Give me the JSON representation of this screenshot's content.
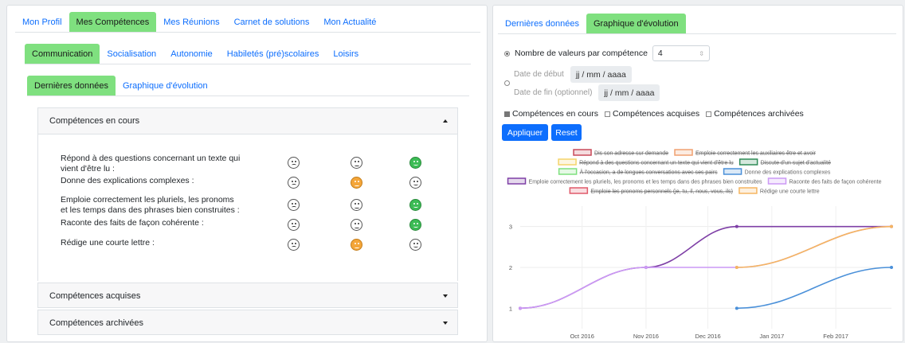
{
  "left": {
    "main_tabs": [
      "Mon Profil",
      "Mes Compétences",
      "Mes Réunions",
      "Carnet de solutions",
      "Mon Actualité"
    ],
    "main_active": 1,
    "sub_tabs": [
      "Communication",
      "Socialisation",
      "Autonomie",
      "Habiletés (pré)scolaires",
      "Loisirs"
    ],
    "sub_active": 0,
    "view_tabs": [
      "Dernières données",
      "Graphique d'évolution"
    ],
    "view_active": 0,
    "accordion": {
      "en_cours": "Compétences en cours",
      "acquises": "Compétences acquises",
      "archivees": "Compétences archivées"
    },
    "competences": [
      {
        "line1": "Répond à des questions concernant un texte qui",
        "line2": "vient d'être lu :",
        "level": "green"
      },
      {
        "line1": "Donne des explications complexes :",
        "line2": "",
        "level": "orange"
      },
      {
        "line1": "Emploie correctement les pluriels, les pronoms",
        "line2": "et les temps dans des phrases bien construites :",
        "level": "green"
      },
      {
        "line1": "Raconte des faits de façon cohérente :",
        "line2": "",
        "level": "green"
      },
      {
        "line1": "Rédige une courte lettre :",
        "line2": "",
        "level": "orange"
      }
    ]
  },
  "right": {
    "tabs": [
      "Dernières données",
      "Graphique d'évolution"
    ],
    "active": 1,
    "nb_label": "Nombre de valeurs par compétence",
    "nb_value": "4",
    "date_debut_label": "Date de début",
    "date_fin_label": "Date de fin (optionnel)",
    "date_placeholder": "jj / mm / aaaa",
    "checks": [
      "Compétences en cours",
      "Compétences acquises",
      "Compétences archivées"
    ],
    "apply": "Appliquer",
    "reset": "Reset"
  },
  "chart_data": {
    "type": "line",
    "x_ticks": [
      "Oct 2016",
      "Nov 2016",
      "Dec 2016",
      "Jan 2017",
      "Feb 2017"
    ],
    "y_ticks": [
      1,
      2,
      3
    ],
    "ylim": [
      0.5,
      3.5
    ],
    "xlim": [
      "2016-09-01",
      "2017-02-28"
    ],
    "legend_position": "top",
    "legend": [
      {
        "name": "Dis son adresse sur demande",
        "color": "#c94a5a",
        "hidden": true
      },
      {
        "name": "Emploie correctement les auxiliaires être et avoir",
        "color": "#f0a070",
        "hidden": true
      },
      {
        "name": "Répond à des questions concernant un texte qui vient d'être lu",
        "color": "#f5d46a",
        "hidden": true
      },
      {
        "name": "Discute d'un sujet d'actualité",
        "color": "#2e8b57",
        "hidden": true
      },
      {
        "name": "À l'occasion, a de longues conversations avec ses pairs",
        "color": "#7ee07e",
        "hidden": true
      },
      {
        "name": "Donne des explications complexes",
        "color": "#4a90d9",
        "hidden": false
      },
      {
        "name": "Emploie correctement les pluriels, les pronoms et les temps dans des phrases bien construites",
        "color": "#7e3fa6",
        "hidden": false
      },
      {
        "name": "Raconte des faits de façon cohérente",
        "color": "#cc99f5",
        "hidden": false
      },
      {
        "name": "Emploie les pronoms personnels (je, tu, il, nous, vous, ils)",
        "color": "#e05a6a",
        "hidden": true
      },
      {
        "name": "Rédige une courte lettre",
        "color": "#f5b560",
        "hidden": false
      }
    ],
    "series": [
      {
        "name": "Emploie correctement les pluriels, les pronoms et les temps dans des phrases bien construites",
        "color": "#7e3fa6",
        "points": [
          [
            "2016-09-01",
            1
          ],
          [
            "2016-11-01",
            2
          ],
          [
            "2016-12-15",
            3
          ],
          [
            "2017-02-28",
            3
          ]
        ]
      },
      {
        "name": "Raconte des faits de façon cohérente",
        "color": "#cc99f5",
        "points": [
          [
            "2016-09-01",
            1
          ],
          [
            "2016-11-01",
            2
          ],
          [
            "2016-12-15",
            2
          ],
          [
            "2017-02-28",
            3
          ]
        ]
      },
      {
        "name": "Rédige une courte lettre",
        "color": "#f5b560",
        "points": [
          [
            "2016-12-15",
            2
          ],
          [
            "2017-02-28",
            3
          ]
        ]
      },
      {
        "name": "Donne des explications complexes",
        "color": "#4a90d9",
        "points": [
          [
            "2016-12-15",
            1
          ],
          [
            "2017-02-28",
            2
          ]
        ]
      }
    ]
  }
}
